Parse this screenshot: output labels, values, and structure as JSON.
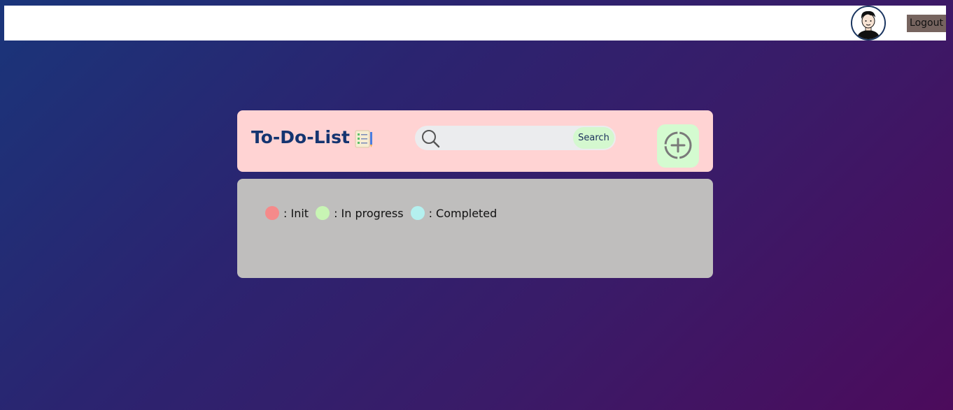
{
  "header": {
    "avatar_icon": "user-avatar-icon",
    "logout_label": "Logout"
  },
  "todo": {
    "title": "To-Do-List",
    "title_icon": "checklist-icon",
    "search": {
      "placeholder": "",
      "value": "",
      "button_label": "Search",
      "icon": "search-icon"
    },
    "add_button": {
      "icon": "add-circle-icon"
    }
  },
  "legend": [
    {
      "label": ": Init",
      "color": "#f58a8a"
    },
    {
      "label": ": In progress",
      "color": "#c8f5b4"
    },
    {
      "label": ": Completed",
      "color": "#b4f0ef"
    }
  ],
  "colors": {
    "header_card": "#ffd3d3",
    "list_card": "#bfbebd",
    "title": "#143470",
    "search_button": "#d4f8cf",
    "add_button": "#d4fbd0",
    "logout_button": "#76645f"
  }
}
